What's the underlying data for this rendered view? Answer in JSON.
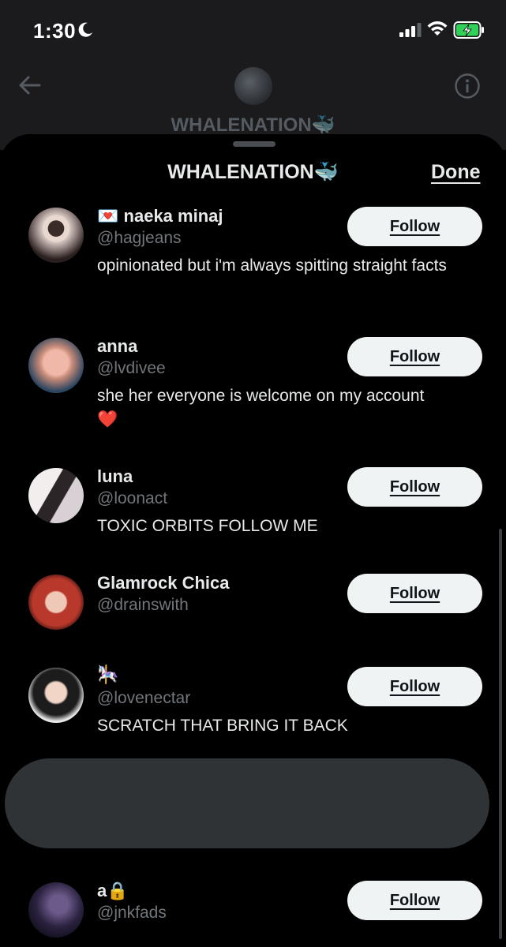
{
  "status_bar": {
    "time": "1:30",
    "icons": [
      "moon-icon",
      "signal-icon",
      "wifi-icon",
      "battery-charging-icon"
    ]
  },
  "background_header": {
    "title": "WHALENATION",
    "title_emoji": "🐳",
    "icons": [
      "back-arrow-icon",
      "info-icon"
    ]
  },
  "sheet": {
    "title": "WHALENATION",
    "title_emoji": "🐳",
    "done_label": "Done"
  },
  "follow_label": "Follow",
  "users": [
    {
      "name_prefix_emoji": "💌",
      "name": "naeka minaj",
      "handle": "@hagjeans",
      "bio": "opinionated but i'm always spitting straight facts",
      "avatar_icon": "avatar-icon"
    },
    {
      "name": "anna",
      "handle": "@lvdivee",
      "bio": "she her everyone is welcome on my account",
      "bio_emoji": "❤️",
      "avatar_icon": "avatar-icon"
    },
    {
      "name": "luna",
      "handle": "@loonact",
      "bio": "TOXIC ORBITS FOLLOW ME",
      "avatar_icon": "avatar-icon"
    },
    {
      "name": "Glamrock Chica",
      "handle": "@drainswith",
      "bio": "",
      "avatar_icon": "avatar-icon"
    },
    {
      "name": "🎠",
      "handle": "@lovenectar",
      "bio": "SCRATCH THAT BRING IT BACK",
      "avatar_icon": "avatar-icon"
    },
    {
      "name": "a",
      "name_suffix_emoji": "🔒",
      "handle": "@jnkfads",
      "bio": "",
      "avatar_icon": "avatar-icon"
    }
  ]
}
